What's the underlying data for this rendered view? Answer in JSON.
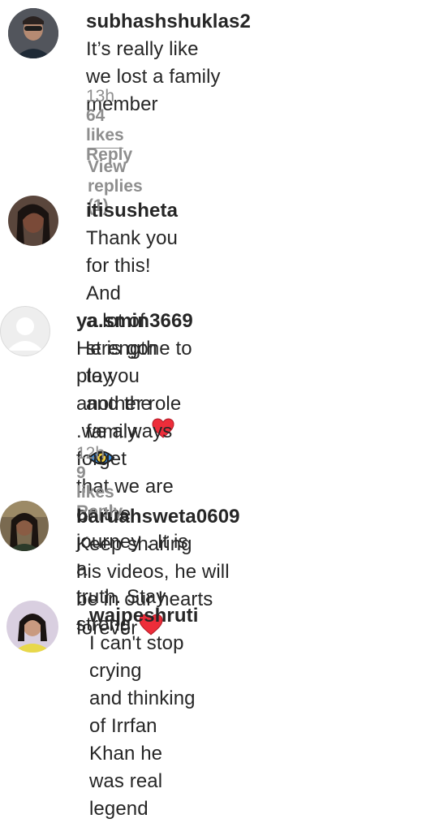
{
  "comments": [
    {
      "username": "subhashshuklas2",
      "text_line1": "It’s really like",
      "text_line2": "we lost a family member",
      "time": "13h",
      "likes": "64 likes",
      "reply": "Reply",
      "view_replies": "View replies (1)"
    },
    {
      "username": "itisusheta",
      "text_line1": "Thank you for this! And",
      "text_line2": "a lot of strength to you and the",
      "text_line3": "family.",
      "emoji": [
        "red-heart-icon",
        "eye-symbol-icon"
      ]
    },
    {
      "username": "ya.smin3669",
      "text_line1": "He is gone to play",
      "text_line2": "another role .we always forget",
      "text_line3": "that we are on the journey . It is a",
      "text_line4": "truth. Stay strong",
      "time": "12h",
      "likes": "9 likes",
      "reply": "Reply"
    },
    {
      "username": "baruahsweta0609",
      "text_line1": "Keep sharing",
      "text_line2": "his videos, he will be in our hearts",
      "text_line3": "forever",
      "emoji": [
        "red-heart-icon"
      ]
    },
    {
      "username": "wajpeshruti",
      "text_line1": "I can't stop crying",
      "text_line2": "and thinking of Irrfan Khan he",
      "text_line3": "was real legend"
    }
  ],
  "colors": {
    "text": "#262626",
    "meta": "#8e8e8e",
    "heart": "#ed2d3a"
  }
}
